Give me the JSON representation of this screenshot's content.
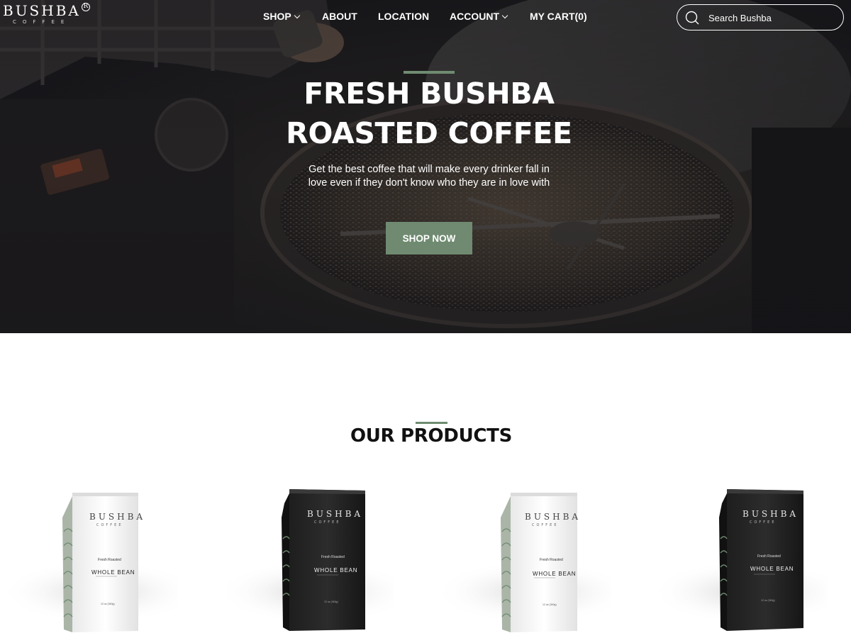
{
  "header": {
    "logo": {
      "word": "BUSHBA",
      "registered": "R",
      "sub": "COFFEE"
    },
    "nav": {
      "shop": "SHOP",
      "about": "ABOUT",
      "location": "LOCATION",
      "account": "ACCOUNT",
      "cart": "MY CART(0)"
    },
    "search": {
      "placeholder": "Search Bushba",
      "icon": "search-icon"
    }
  },
  "hero": {
    "title_line1": "FRESH BUSHBA",
    "title_line2": "ROASTED COFFEE",
    "subtitle_line1": "Get the best coffee that will make every drinker fall in",
    "subtitle_line2": "love even if they don't know who they are in love with",
    "button": "SHOP NOW"
  },
  "products": {
    "title": "OUR PRODUCTS",
    "items": [
      {
        "brand": "BUSHBA",
        "sub": "COFFEE",
        "fresh": "Fresh Roasted",
        "type": "WHOLE BEAN",
        "weight": "12 oz (340g)",
        "color": "white"
      },
      {
        "brand": "BUSHBA",
        "sub": "COFFEE",
        "fresh": "Fresh Roasted",
        "type": "WHOLE BEAN",
        "weight": "12 oz (340g)",
        "color": "black"
      },
      {
        "brand": "BUSHBA",
        "sub": "COFFEE",
        "fresh": "Fresh Roasted",
        "type": "WHOLE BEAN",
        "weight": "12 oz (340g)",
        "color": "white"
      },
      {
        "brand": "BUSHBA",
        "sub": "COFFEE",
        "fresh": "Fresh Roasted",
        "type": "WHOLE BEAN",
        "weight": "12 oz (340g)",
        "color": "black"
      }
    ]
  },
  "colors": {
    "accent": "#6f8a70",
    "hero_dark": "#1a191c",
    "text_dark": "#111111"
  }
}
